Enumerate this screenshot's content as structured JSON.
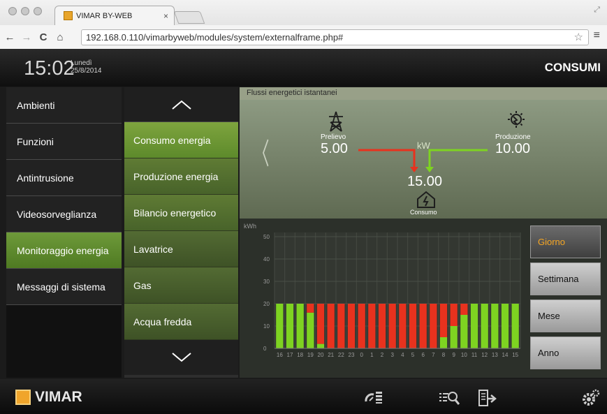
{
  "browser": {
    "tab_title": "VIMAR BY-WEB",
    "tab_close": "×",
    "url": "192.168.0.110/vimarbyweb/modules/system/externalframe.php#",
    "back": "←",
    "forward": "→",
    "reload": "C",
    "home": "⌂",
    "star": "☆",
    "menu": "≡",
    "fullscreen": "⤢"
  },
  "header": {
    "time": "15:02",
    "day": "Lunedì",
    "date": "25/8/2014",
    "title": "CONSUMI"
  },
  "left_menu": [
    {
      "label": "Ambienti",
      "active": false
    },
    {
      "label": "Funzioni",
      "active": false
    },
    {
      "label": "Antintrusione",
      "active": false
    },
    {
      "label": "Videosorveglianza",
      "active": false
    },
    {
      "label": "Monitoraggio energia",
      "active": true
    },
    {
      "label": "Messaggi di sistema",
      "active": false
    }
  ],
  "sub_menu": [
    {
      "label": "Consumo energia",
      "active": true
    },
    {
      "label": "Produzione energia",
      "active": false
    },
    {
      "label": "Bilancio energetico",
      "active": false
    },
    {
      "label": "Lavatrice",
      "active": false
    },
    {
      "label": "Gas",
      "active": false
    },
    {
      "label": "Acqua fredda",
      "active": false
    }
  ],
  "flow": {
    "section_title": "Flussi energetici istantanei",
    "unit": "kW",
    "prelievo_label": "Prelievo",
    "prelievo_value": "5.00",
    "produzione_label": "Produzione",
    "produzione_value": "10.00",
    "consumo_label": "Consumo",
    "consumo_value": "15.00",
    "arrow_left": "〈"
  },
  "period_buttons": [
    {
      "label": "Giorno",
      "selected": true
    },
    {
      "label": "Settimana",
      "selected": false
    },
    {
      "label": "Mese",
      "selected": false
    },
    {
      "label": "Anno",
      "selected": false
    }
  ],
  "footer": {
    "brand": "VIMAR"
  },
  "colors": {
    "accent_green": "#6e9a3a",
    "bar_green": "#7ed321",
    "bar_red": "#e8321e",
    "selected_text": "#f6a623"
  },
  "chart_data": {
    "type": "bar",
    "ylabel": "kWh",
    "ylim": [
      0,
      50
    ],
    "yticks": [
      0,
      10,
      20,
      30,
      40,
      50
    ],
    "categories": [
      "16",
      "17",
      "18",
      "19",
      "20",
      "21",
      "22",
      "23",
      "0",
      "1",
      "2",
      "3",
      "4",
      "5",
      "6",
      "7",
      "8",
      "9",
      "10",
      "11",
      "12",
      "13",
      "14",
      "15"
    ],
    "series": [
      {
        "color": "#7ed321",
        "values": [
          20,
          20,
          20,
          16,
          2,
          0,
          0,
          0,
          0,
          0,
          0,
          0,
          0,
          0,
          0,
          0,
          5,
          10,
          15,
          20,
          20,
          20,
          20,
          20
        ]
      },
      {
        "color": "#e8321e",
        "values": [
          0,
          0,
          0,
          4,
          18,
          20,
          20,
          20,
          20,
          20,
          20,
          20,
          20,
          20,
          20,
          20,
          15,
          10,
          5,
          0,
          0,
          0,
          0,
          0
        ]
      }
    ],
    "grid": true,
    "stacked": true
  }
}
